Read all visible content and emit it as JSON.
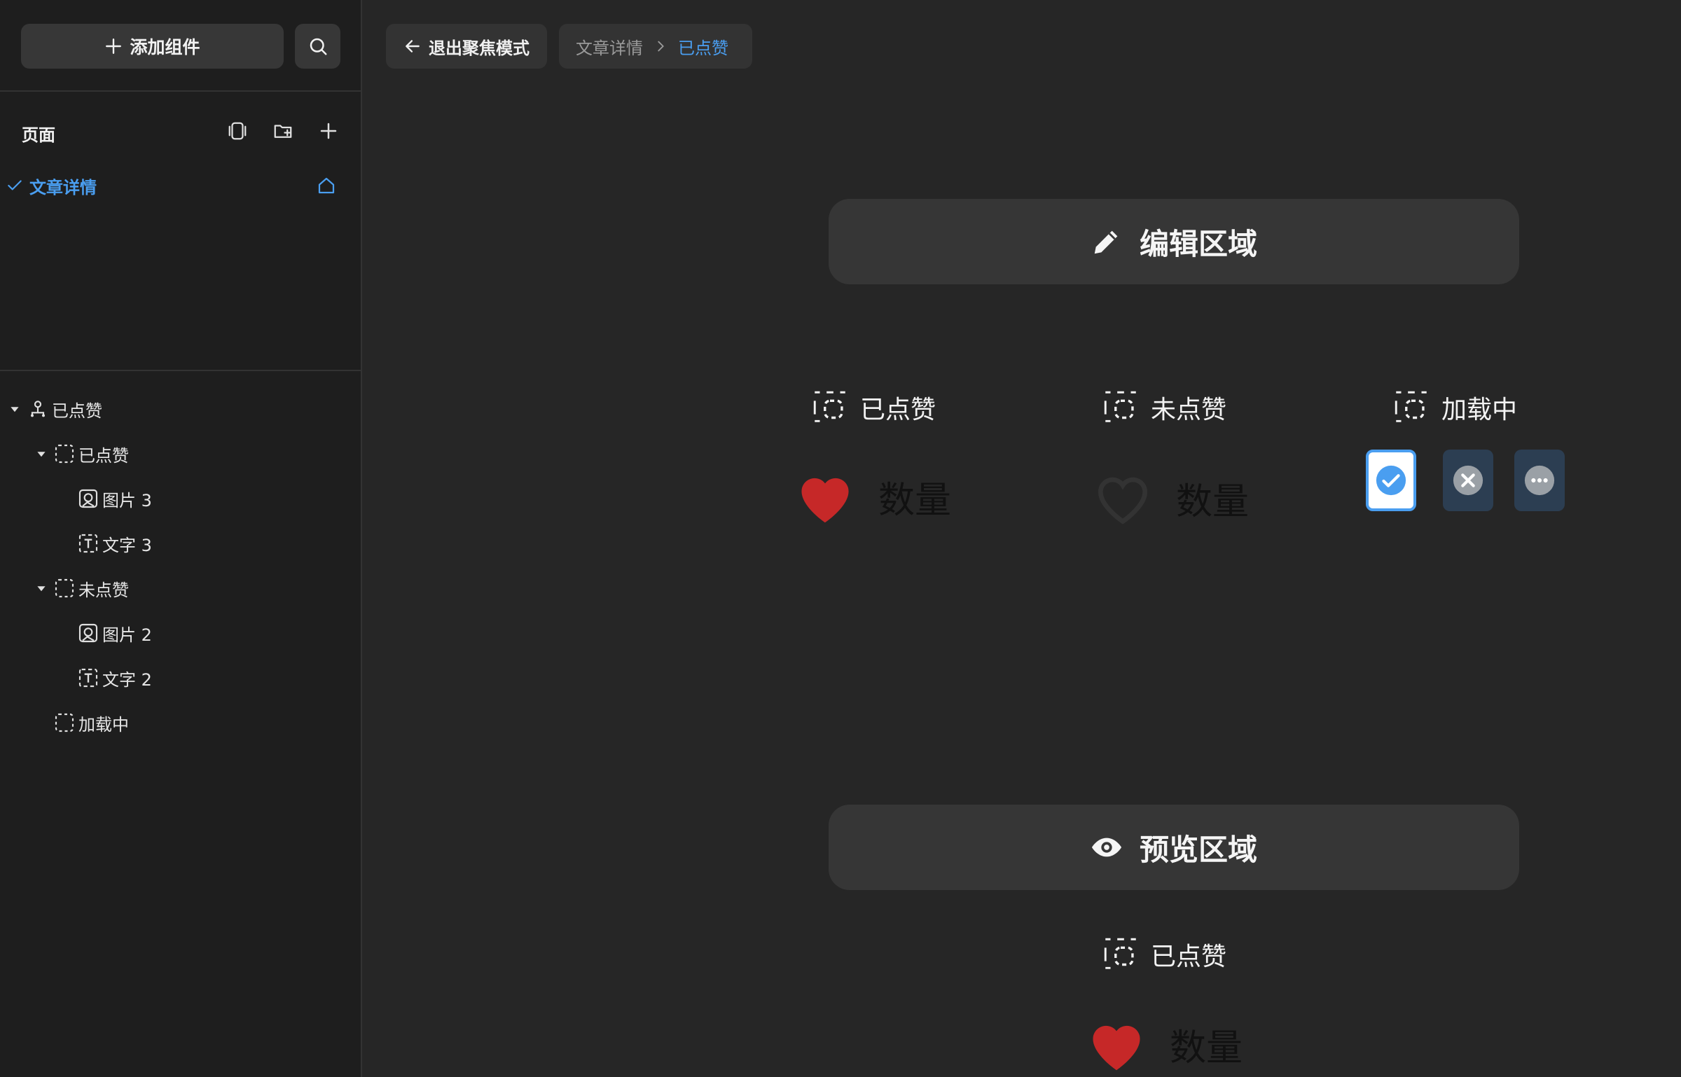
{
  "sidebar": {
    "add_component_label": "添加组件",
    "pages_title": "页面",
    "pages": [
      {
        "label": "文章详情",
        "selected": true
      }
    ],
    "tree": [
      {
        "label": "已点赞",
        "type": "component"
      },
      {
        "label": "已点赞",
        "type": "variant"
      },
      {
        "label": "图片 3",
        "type": "image"
      },
      {
        "label": "文字 3",
        "type": "text"
      },
      {
        "label": "未点赞",
        "type": "variant"
      },
      {
        "label": "图片 2",
        "type": "image"
      },
      {
        "label": "文字 2",
        "type": "text"
      },
      {
        "label": "加载中",
        "type": "variant"
      }
    ]
  },
  "topbar": {
    "exit_label": "退出聚焦模式",
    "breadcrumb": {
      "parent": "文章详情",
      "current": "已点赞"
    }
  },
  "canvas": {
    "edit_area_label": "编辑区域",
    "preview_area_label": "预览区域",
    "variants": [
      {
        "label": "已点赞",
        "count_label": "数量",
        "liked": true
      },
      {
        "label": "未点赞",
        "count_label": "数量",
        "liked": false
      },
      {
        "label": "加载中"
      }
    ],
    "preview": {
      "label": "已点赞",
      "count_label": "数量",
      "liked": true
    }
  },
  "colors": {
    "accent": "#4a9ef0",
    "heart_red": "#c62828",
    "heart_outline": "#333333"
  }
}
